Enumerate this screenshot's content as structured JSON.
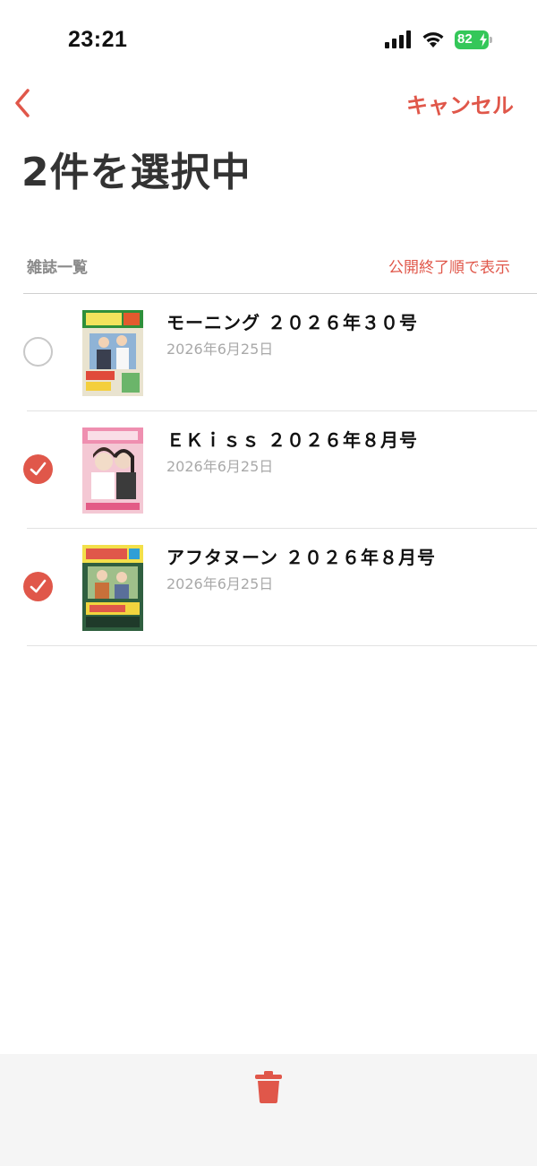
{
  "status_bar": {
    "time": "23:21",
    "battery_level": "82",
    "battery_color": "#34c759"
  },
  "nav": {
    "back_icon": "chevron-left-icon",
    "cancel_label": "キャンセル"
  },
  "title": "2件を選択中",
  "section": {
    "label": "雑誌一覧",
    "sort_label": "公開終了順で表示"
  },
  "items": [
    {
      "title": "モーニング ２０２６年３０号",
      "date": "2026年6月25日",
      "selected": false
    },
    {
      "title": "ＥＫｉｓｓ ２０２６年８月号",
      "date": "2026年6月25日",
      "selected": true
    },
    {
      "title": "アフタヌーン ２０２６年８月号",
      "date": "2026年6月25日",
      "selected": true
    }
  ],
  "toolbar": {
    "delete_icon": "trash-icon"
  },
  "colors": {
    "accent": "#e0574a",
    "bottom_bar": "#f5f5f5"
  }
}
